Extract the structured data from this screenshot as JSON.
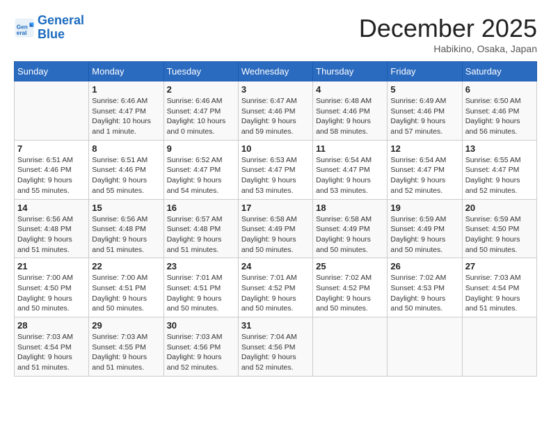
{
  "header": {
    "logo_line1": "General",
    "logo_line2": "Blue",
    "month": "December 2025",
    "location": "Habikino, Osaka, Japan"
  },
  "weekdays": [
    "Sunday",
    "Monday",
    "Tuesday",
    "Wednesday",
    "Thursday",
    "Friday",
    "Saturday"
  ],
  "weeks": [
    [
      {
        "day": "",
        "info": ""
      },
      {
        "day": "1",
        "info": "Sunrise: 6:46 AM\nSunset: 4:47 PM\nDaylight: 10 hours\nand 1 minute."
      },
      {
        "day": "2",
        "info": "Sunrise: 6:46 AM\nSunset: 4:47 PM\nDaylight: 10 hours\nand 0 minutes."
      },
      {
        "day": "3",
        "info": "Sunrise: 6:47 AM\nSunset: 4:46 PM\nDaylight: 9 hours\nand 59 minutes."
      },
      {
        "day": "4",
        "info": "Sunrise: 6:48 AM\nSunset: 4:46 PM\nDaylight: 9 hours\nand 58 minutes."
      },
      {
        "day": "5",
        "info": "Sunrise: 6:49 AM\nSunset: 4:46 PM\nDaylight: 9 hours\nand 57 minutes."
      },
      {
        "day": "6",
        "info": "Sunrise: 6:50 AM\nSunset: 4:46 PM\nDaylight: 9 hours\nand 56 minutes."
      }
    ],
    [
      {
        "day": "7",
        "info": "Sunrise: 6:51 AM\nSunset: 4:46 PM\nDaylight: 9 hours\nand 55 minutes."
      },
      {
        "day": "8",
        "info": "Sunrise: 6:51 AM\nSunset: 4:46 PM\nDaylight: 9 hours\nand 55 minutes."
      },
      {
        "day": "9",
        "info": "Sunrise: 6:52 AM\nSunset: 4:47 PM\nDaylight: 9 hours\nand 54 minutes."
      },
      {
        "day": "10",
        "info": "Sunrise: 6:53 AM\nSunset: 4:47 PM\nDaylight: 9 hours\nand 53 minutes."
      },
      {
        "day": "11",
        "info": "Sunrise: 6:54 AM\nSunset: 4:47 PM\nDaylight: 9 hours\nand 53 minutes."
      },
      {
        "day": "12",
        "info": "Sunrise: 6:54 AM\nSunset: 4:47 PM\nDaylight: 9 hours\nand 52 minutes."
      },
      {
        "day": "13",
        "info": "Sunrise: 6:55 AM\nSunset: 4:47 PM\nDaylight: 9 hours\nand 52 minutes."
      }
    ],
    [
      {
        "day": "14",
        "info": "Sunrise: 6:56 AM\nSunset: 4:48 PM\nDaylight: 9 hours\nand 51 minutes."
      },
      {
        "day": "15",
        "info": "Sunrise: 6:56 AM\nSunset: 4:48 PM\nDaylight: 9 hours\nand 51 minutes."
      },
      {
        "day": "16",
        "info": "Sunrise: 6:57 AM\nSunset: 4:48 PM\nDaylight: 9 hours\nand 51 minutes."
      },
      {
        "day": "17",
        "info": "Sunrise: 6:58 AM\nSunset: 4:49 PM\nDaylight: 9 hours\nand 50 minutes."
      },
      {
        "day": "18",
        "info": "Sunrise: 6:58 AM\nSunset: 4:49 PM\nDaylight: 9 hours\nand 50 minutes."
      },
      {
        "day": "19",
        "info": "Sunrise: 6:59 AM\nSunset: 4:49 PM\nDaylight: 9 hours\nand 50 minutes."
      },
      {
        "day": "20",
        "info": "Sunrise: 6:59 AM\nSunset: 4:50 PM\nDaylight: 9 hours\nand 50 minutes."
      }
    ],
    [
      {
        "day": "21",
        "info": "Sunrise: 7:00 AM\nSunset: 4:50 PM\nDaylight: 9 hours\nand 50 minutes."
      },
      {
        "day": "22",
        "info": "Sunrise: 7:00 AM\nSunset: 4:51 PM\nDaylight: 9 hours\nand 50 minutes."
      },
      {
        "day": "23",
        "info": "Sunrise: 7:01 AM\nSunset: 4:51 PM\nDaylight: 9 hours\nand 50 minutes."
      },
      {
        "day": "24",
        "info": "Sunrise: 7:01 AM\nSunset: 4:52 PM\nDaylight: 9 hours\nand 50 minutes."
      },
      {
        "day": "25",
        "info": "Sunrise: 7:02 AM\nSunset: 4:52 PM\nDaylight: 9 hours\nand 50 minutes."
      },
      {
        "day": "26",
        "info": "Sunrise: 7:02 AM\nSunset: 4:53 PM\nDaylight: 9 hours\nand 50 minutes."
      },
      {
        "day": "27",
        "info": "Sunrise: 7:03 AM\nSunset: 4:54 PM\nDaylight: 9 hours\nand 51 minutes."
      }
    ],
    [
      {
        "day": "28",
        "info": "Sunrise: 7:03 AM\nSunset: 4:54 PM\nDaylight: 9 hours\nand 51 minutes."
      },
      {
        "day": "29",
        "info": "Sunrise: 7:03 AM\nSunset: 4:55 PM\nDaylight: 9 hours\nand 51 minutes."
      },
      {
        "day": "30",
        "info": "Sunrise: 7:03 AM\nSunset: 4:56 PM\nDaylight: 9 hours\nand 52 minutes."
      },
      {
        "day": "31",
        "info": "Sunrise: 7:04 AM\nSunset: 4:56 PM\nDaylight: 9 hours\nand 52 minutes."
      },
      {
        "day": "",
        "info": ""
      },
      {
        "day": "",
        "info": ""
      },
      {
        "day": "",
        "info": ""
      }
    ]
  ]
}
